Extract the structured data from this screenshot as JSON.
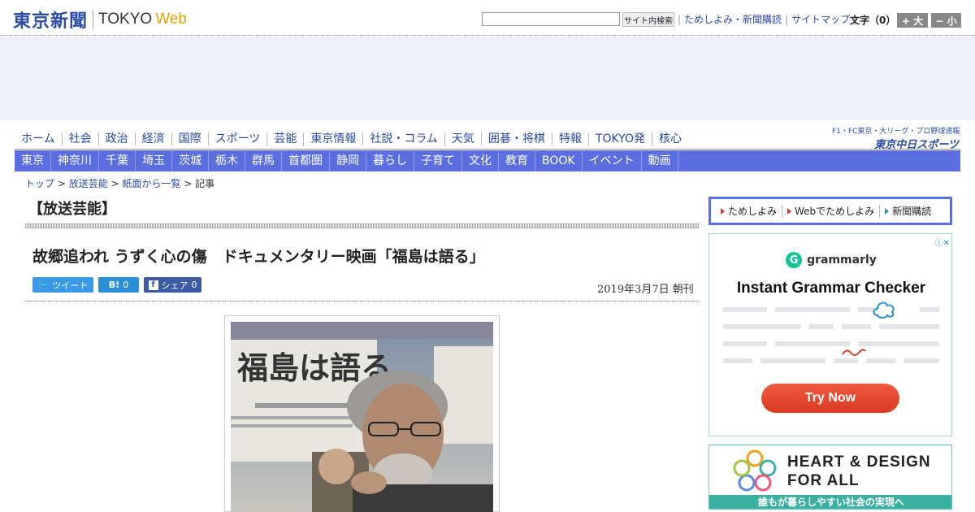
{
  "header": {
    "logo_jp": "東京新聞",
    "logo_en": "TOKYO",
    "logo_web": "Web",
    "search_button": "サイト内検索",
    "links": [
      "ためしよみ・新聞購読",
      "サイトマップ"
    ],
    "font_size_label": "文字（0）",
    "font_plus": "+ 大",
    "font_minus": "− 小"
  },
  "nav_main": [
    "ホーム",
    "社会",
    "政治",
    "経済",
    "国際",
    "スポーツ",
    "芸能",
    "東京情報",
    "社説・コラム",
    "天気",
    "囲碁・将棋",
    "特報",
    "TOKYO発",
    "核心"
  ],
  "chunichi": {
    "top": "F1・FC東京・大リーグ・プロ野球速報",
    "logo": "東京中日スポーツ"
  },
  "nav_region": [
    "東京",
    "神奈川",
    "千葉",
    "埼玉",
    "茨城",
    "栃木",
    "群馬",
    "首都圏",
    "静岡",
    "暮らし",
    "子育て",
    "文化",
    "教育",
    "BOOK",
    "イベント",
    "動画"
  ],
  "breadcrumb": {
    "items": [
      "トップ",
      "放送芸能",
      "紙面から一覧"
    ],
    "current": "記事",
    "sep": " > "
  },
  "article": {
    "section": "【放送芸能】",
    "headline": "故郷追われ うずく心の傷　ドキュメンタリー映画「福島は語る」",
    "date": "2019年3月7日 朝刊",
    "share": {
      "tweet": "ツイート",
      "hatena_icon": "B!",
      "hatena_count": "0",
      "fb_icon": "f",
      "fb_label": "シェア",
      "fb_count": "0"
    },
    "photo_poster_text": "福島は語る"
  },
  "sidebar": {
    "nav": [
      "ためしよみ",
      "Webでためしよみ",
      "新聞購読"
    ],
    "ad1": {
      "brand": "grammarly",
      "title": "Instant Grammar Checker",
      "button": "Try Now"
    },
    "ad2": {
      "line1": "HEART & DESIGN",
      "line2": "FOR ALL",
      "band": "誰もが暮らしやすい社会の実現へ"
    }
  },
  "colors": {
    "brand_blue": "#2a4ba8",
    "nav_bar": "#5a6ee0",
    "twitter": "#3a9ae8",
    "facebook": "#3a5ba4",
    "grammarly_green": "#15c39a",
    "cta_red": "#d93a22"
  }
}
